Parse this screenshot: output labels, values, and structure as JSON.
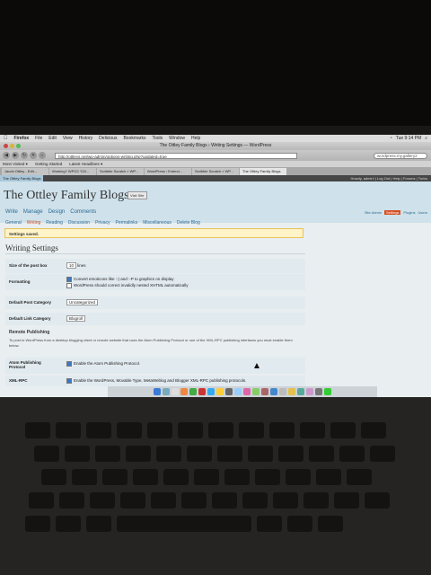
{
  "menubar": {
    "app": "Firefox",
    "items": [
      "File",
      "Edit",
      "View",
      "History",
      "Delicious",
      "Bookmarks",
      "Tools",
      "Window",
      "Help"
    ],
    "clock": "Tue 9:14 PM"
  },
  "window": {
    "title": "The Ottley Family Blogs › Writing Settings — WordPress"
  },
  "navbar": {
    "url": "http://ottleys.net/wp-admin/options-writing.php?updated=true",
    "search": "wordpress.my.gallery2"
  },
  "bookmarks": [
    "Most Visited ▾",
    "Getting Started",
    "Latest Headlines ▾"
  ],
  "tabs": [
    "Jacob Ottley - Edit...",
    "Working? WPG2 'G2l...",
    "Scribble Scratch » WP...",
    "WordPress › Extend...",
    "Scribble Scratch » WP...",
    "The Ottley Family Blogs"
  ],
  "wp": {
    "blog_tag": "The Ottley Family Blogs",
    "user_links": "Howdy, admin! | Log Out | Help | Forums | Turbo",
    "title": "The Ottley Family Blogs",
    "visit_site": "Visit Site",
    "main_menu": [
      "Write",
      "Manage",
      "Design",
      "Comments"
    ],
    "right_menu": [
      "Site Admin",
      "Settings",
      "Plugins",
      "Users"
    ],
    "sub_menu": [
      "General",
      "Writing",
      "Reading",
      "Discussion",
      "Privacy",
      "Permalinks",
      "Miscellaneous",
      "Delete Blog"
    ],
    "notice": "Settings saved.",
    "heading": "Writing Settings",
    "postbox_label": "Size of the post box",
    "postbox_value": "10",
    "postbox_unit": "lines",
    "formatting_label": "Formatting",
    "formatting_opt1": "Convert emoticons like :-) and :-P to graphics on display",
    "formatting_opt2": "WordPress should correct invalidly nested XHTML automatically",
    "category_label": "Default Post Category",
    "category_value": "Uncategorized",
    "link_label": "Default Link Category",
    "link_value": "Blogroll",
    "remote_heading": "Remote Publishing",
    "remote_text": "To post to WordPress from a desktop blogging client or remote website that uses the Atom Publishing Protocol or one of the XML-RPC publishing interfaces you must enable them below.",
    "atom_label": "Atom Publishing Protocol",
    "atom_opt": "Enable the Atom Publishing Protocol.",
    "xmlrpc_label": "XML-RPC",
    "xmlrpc_opt": "Enable the WordPress, Movable Type, MetaWeblog and Blogger XML-RPC publishing protocols."
  },
  "dock_colors": [
    "#3a7bd5",
    "#7ab",
    "#ddd",
    "#e84",
    "#4a4",
    "#c33",
    "#3ae",
    "#fc3",
    "#666",
    "#9cf",
    "#d6a",
    "#8c6",
    "#a66",
    "#48c",
    "#bbb",
    "#e5c04b",
    "#5a9",
    "#c9c",
    "#777",
    "#3c3"
  ]
}
